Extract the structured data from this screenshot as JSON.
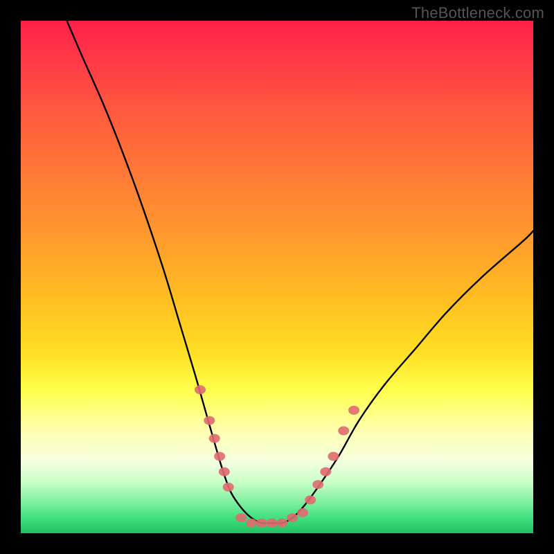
{
  "watermark": "TheBottleneck.com",
  "chart_data": {
    "type": "line",
    "title": "",
    "xlabel": "",
    "ylabel": "",
    "xlim": [
      0,
      100
    ],
    "ylim": [
      0,
      100
    ],
    "grid": false,
    "legend": false,
    "gradient_colors": {
      "top": "#ff1f4a",
      "upper_mid": "#ff9a2e",
      "mid": "#ffe024",
      "lower_mid": "#ffff8c",
      "bottom": "#22c060"
    },
    "series": [
      {
        "name": "bottleneck-curve",
        "type": "line",
        "color": "#000000",
        "x": [
          9,
          12,
          16,
          20,
          24,
          28,
          31,
          34,
          36,
          38,
          39.5,
          41,
          43,
          45,
          47,
          49,
          51,
          53,
          55,
          58,
          62,
          66,
          71,
          77,
          83,
          90,
          98,
          100
        ],
        "y": [
          100,
          93,
          84,
          74,
          63,
          51,
          41,
          31,
          24,
          17,
          12,
          8,
          5,
          3,
          2,
          2,
          2,
          3,
          5,
          9,
          15,
          22,
          29,
          36,
          43,
          50,
          57,
          59
        ]
      },
      {
        "name": "highlight-markers-left",
        "type": "scatter",
        "color": "#e06a70",
        "x": [
          35,
          36.8,
          37.8,
          38.8,
          39.7,
          40.5
        ],
        "y": [
          28,
          22,
          18.5,
          15,
          12,
          9
        ]
      },
      {
        "name": "highlight-markers-bottom",
        "type": "scatter",
        "color": "#e06a70",
        "x": [
          43,
          45,
          47,
          49,
          51,
          53,
          55
        ],
        "y": [
          3,
          2,
          2,
          2,
          2,
          3,
          4
        ]
      },
      {
        "name": "highlight-markers-right",
        "type": "scatter",
        "color": "#e06a70",
        "x": [
          56.5,
          58,
          59.5,
          61,
          63,
          65
        ],
        "y": [
          6.5,
          9.5,
          12,
          15,
          20,
          24
        ]
      }
    ]
  }
}
